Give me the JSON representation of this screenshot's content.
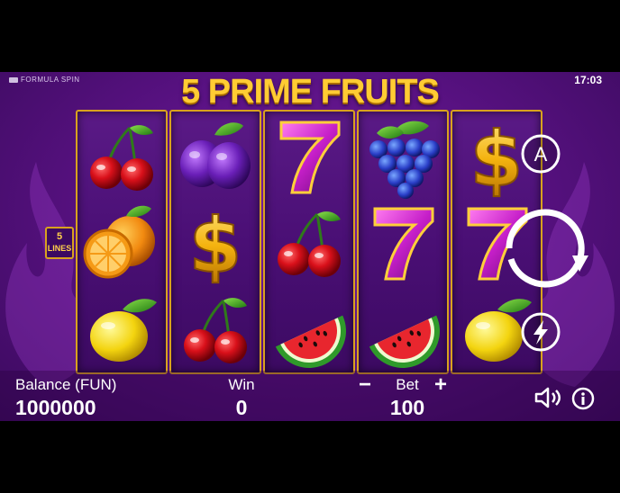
{
  "header": {
    "brand": "FORMULA SPIN",
    "clock": "17:03",
    "game_title": "5 PRIME FRUITS"
  },
  "lines_badge": {
    "count": "5",
    "label": "LINES"
  },
  "reels": [
    [
      "cherry-icon",
      "orange-icon",
      "lemon-icon"
    ],
    [
      "plum-icon",
      "dollar-icon",
      "cherry-icon"
    ],
    [
      "seven-icon",
      "cherry-icon",
      "watermelon-icon"
    ],
    [
      "grapes-icon",
      "seven-icon",
      "watermelon-icon"
    ],
    [
      "dollar-icon",
      "seven-icon",
      "lemon-icon"
    ]
  ],
  "controls": {
    "autoplay": "A",
    "spin": "spin-icon",
    "turbo": "lightning-icon"
  },
  "footer": {
    "balance_label": "Balance (FUN)",
    "balance_value": "1000000",
    "win_label": "Win",
    "win_value": "0",
    "bet_label": "Bet",
    "bet_value": "100",
    "bet_minus": "−",
    "bet_plus": "+"
  },
  "colors": {
    "gold": "#d9a21e",
    "title": "#ffcc33",
    "background": "#5a1284"
  }
}
